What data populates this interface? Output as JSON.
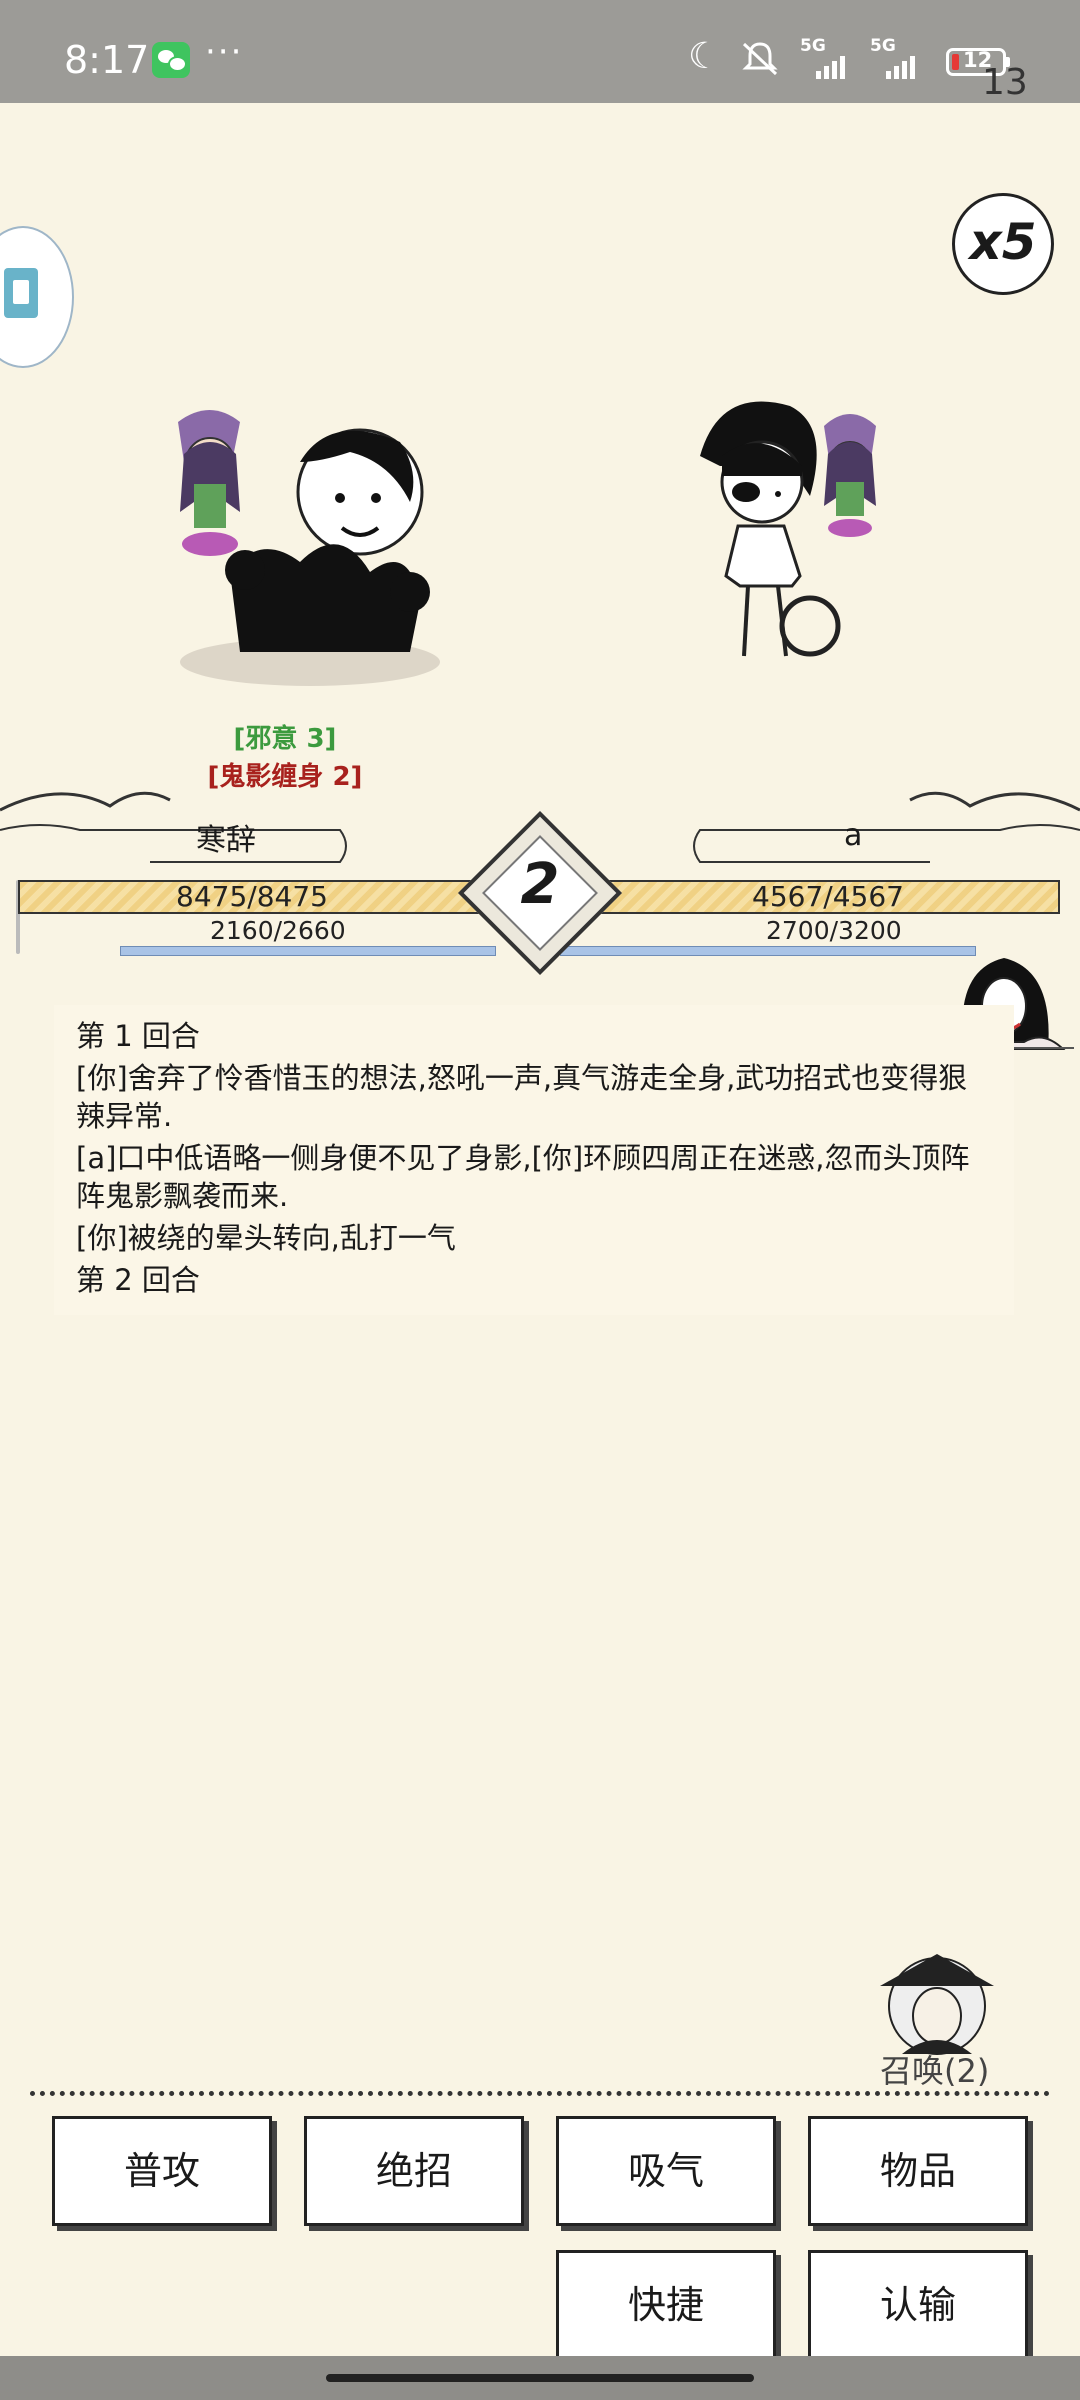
{
  "status_bar": {
    "time": "8:17",
    "more": "···",
    "network_left": "5G",
    "network_right": "5G",
    "battery": "12",
    "corner_number": "13"
  },
  "speed_badge": "x5",
  "status_effects": [
    "[邪意 3]",
    "[鬼影缠身 2]"
  ],
  "player": {
    "name": "寒辞",
    "hp": "8475/8475",
    "mp": "2160/2660",
    "hp_fraction": 1.0,
    "mp_fraction": 0.81
  },
  "opponent": {
    "name": "a",
    "hp": "4567/4567",
    "mp": "2700/3200",
    "hp_fraction": 1.0,
    "mp_fraction": 0.84
  },
  "round": "2",
  "log": [
    "第 1 回合",
    "[你]舍弃了怜香惜玉的想法,怒吼一声,真气游走全身,武功招式也变得狠辣异常.",
    "[a]口中低语略一侧身便不见了身影,[你]环顾四周正在迷惑,忽而头顶阵阵鬼影飘袭而来.",
    "[你]被绕的晕头转向,乱打一气",
    "第 2 回合"
  ],
  "summon_label": "召唤(2)",
  "actions": {
    "attack": "普攻",
    "ultimate": "绝招",
    "absorb": "吸气",
    "items": "物品",
    "shortcut": "快捷",
    "surrender": "认输"
  },
  "colors": {
    "background": "#f9f4e4",
    "hp": "#f0d184",
    "mp": "#a9c3e6",
    "status_green": "#3c9a3e",
    "status_red": "#a8211d"
  }
}
